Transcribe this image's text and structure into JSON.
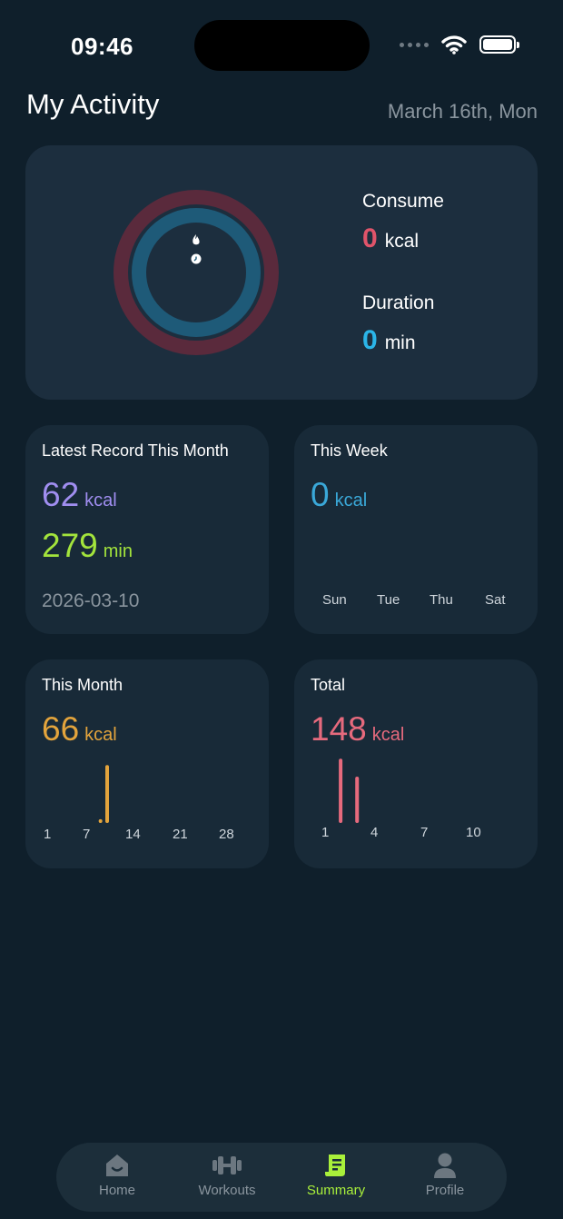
{
  "status_bar": {
    "time": "09:46"
  },
  "header": {
    "title": "My Activity",
    "date": "March 16th, Mon"
  },
  "summary": {
    "consume_label": "Consume",
    "consume_value": "0",
    "consume_unit": "kcal",
    "duration_label": "Duration",
    "duration_value": "0",
    "duration_unit": "min",
    "colors": {
      "consume": "#e0546a",
      "duration": "#2bb5e8"
    }
  },
  "latest_record": {
    "title": "Latest Record This Month",
    "kcal_value": "62",
    "kcal_unit": "kcal",
    "min_value": "279",
    "min_unit": "min",
    "date": "2026-03-10"
  },
  "this_week": {
    "title": "This Week",
    "value": "0",
    "unit": "kcal",
    "days": [
      "Sun",
      "Tue",
      "Thu",
      "Sat"
    ]
  },
  "this_month": {
    "title": "This Month",
    "value": "66",
    "unit": "kcal",
    "ticks": [
      "1",
      "7",
      "14",
      "21",
      "28"
    ]
  },
  "total": {
    "title": "Total",
    "value": "148",
    "unit": "kcal",
    "ticks": [
      "1",
      "4",
      "7",
      "10"
    ]
  },
  "chart_data": [
    {
      "type": "bar",
      "title": "This Month",
      "x_ticks": [
        "1",
        "7",
        "14",
        "21",
        "28"
      ],
      "x": [
        9,
        10
      ],
      "values": [
        4,
        62
      ],
      "color": "#e3a43c"
    },
    {
      "type": "bar",
      "title": "Total",
      "x_ticks": [
        "1",
        "4",
        "7",
        "10"
      ],
      "x": [
        2,
        3
      ],
      "values": [
        86,
        62
      ],
      "color": "#e66a7d"
    }
  ],
  "tabs": [
    {
      "label": "Home",
      "icon": "home-icon"
    },
    {
      "label": "Workouts",
      "icon": "dumbbell-icon"
    },
    {
      "label": "Summary",
      "icon": "summary-scroll-icon"
    },
    {
      "label": "Profile",
      "icon": "profile-icon"
    }
  ]
}
